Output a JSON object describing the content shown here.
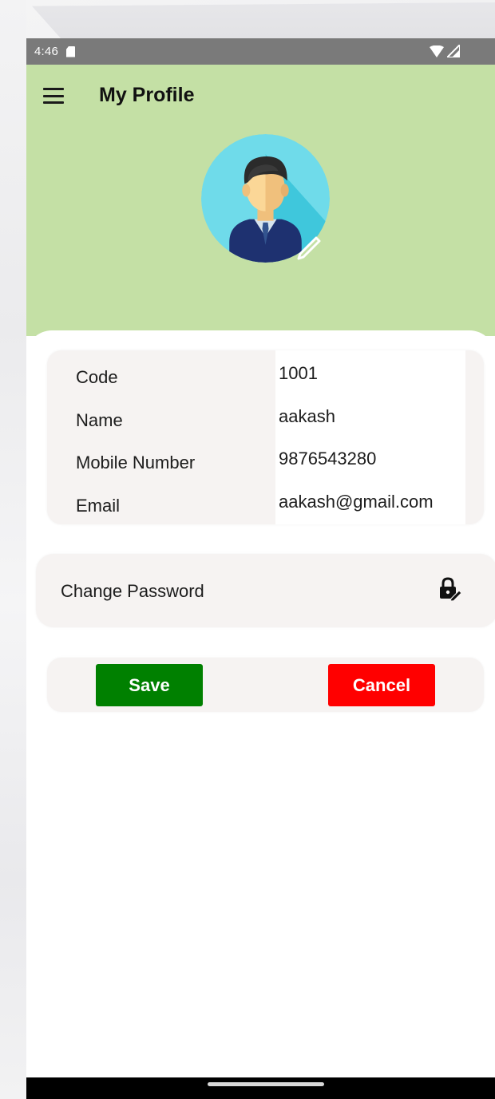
{
  "status_bar": {
    "time": "4:46",
    "icons": [
      "sd-card-icon",
      "wifi-icon",
      "signal-icon"
    ]
  },
  "header": {
    "title": "My Profile",
    "menu_icon": "hamburger-menu-icon",
    "avatar_icon": "user-avatar-icon",
    "edit_icon": "pencil-icon"
  },
  "profile": {
    "fields": [
      {
        "label": "Code",
        "value": "1001"
      },
      {
        "label": "Name",
        "value": "aakash"
      },
      {
        "label": "Mobile Number",
        "value": "9876543280"
      },
      {
        "label": "Email",
        "value": "aakash@gmail.com"
      }
    ]
  },
  "password": {
    "label": "Change Password",
    "icon": "lock-edit-icon"
  },
  "actions": {
    "save_label": "Save",
    "cancel_label": "Cancel"
  },
  "colors": {
    "header_bg": "#c4e0a5",
    "save_bg": "#008000",
    "cancel_bg": "#ff0000",
    "card_bg": "#f6f3f2"
  }
}
